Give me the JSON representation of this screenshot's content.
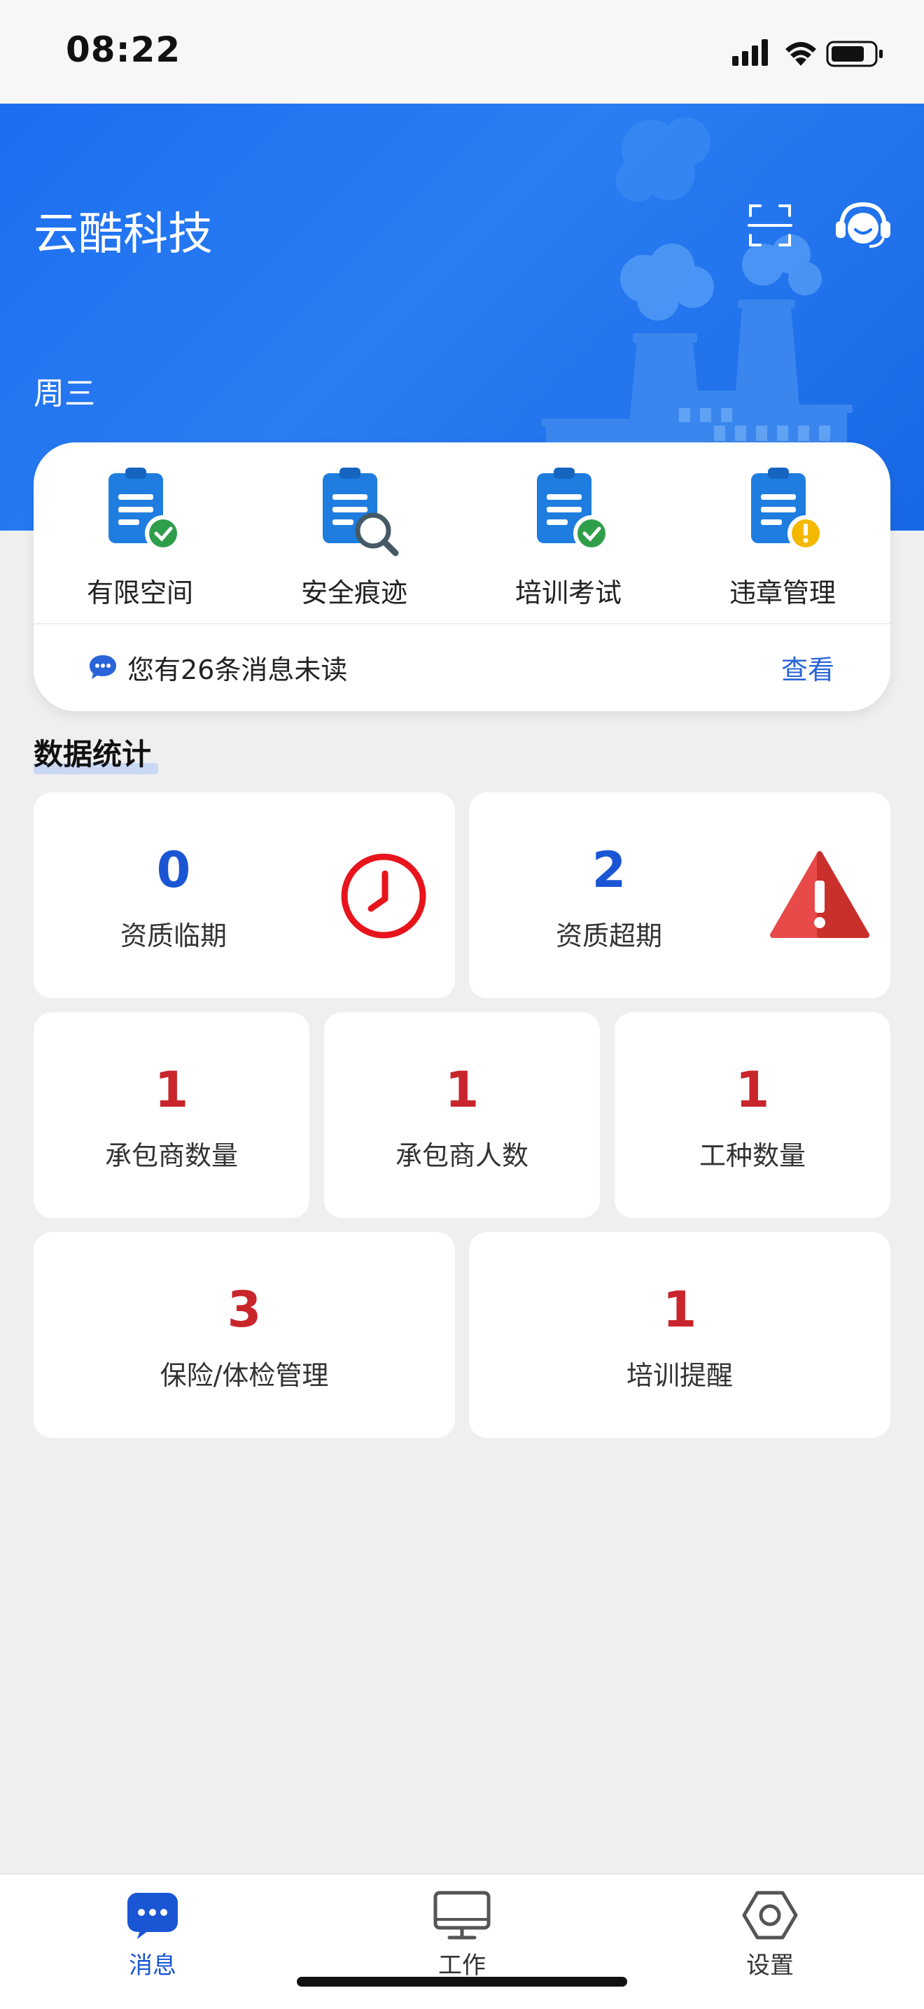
{
  "status_bar": {
    "time": "08:22"
  },
  "header": {
    "app_title": "云酷科技",
    "weekday": "周三",
    "scan_icon": "scan-icon",
    "support_icon": "customer-service-icon"
  },
  "quick_actions": [
    {
      "label": "有限空间",
      "icon": "clipboard-check-icon"
    },
    {
      "label": "安全痕迹",
      "icon": "clipboard-search-icon"
    },
    {
      "label": "培训考试",
      "icon": "clipboard-check-icon"
    },
    {
      "label": "违章管理",
      "icon": "clipboard-warning-icon"
    }
  ],
  "messages": {
    "text": "您有26条消息未读",
    "link": "查看",
    "icon": "chat-bubble-icon"
  },
  "stats_section": {
    "title": "数据统计"
  },
  "stats": {
    "qual_expiring": {
      "value": "0",
      "label": "资质临期",
      "icon": "clock-icon"
    },
    "qual_expired": {
      "value": "2",
      "label": "资质超期",
      "icon": "warning-triangle-icon"
    },
    "contractor_count": {
      "value": "1",
      "label": "承包商数量"
    },
    "contractor_people": {
      "value": "1",
      "label": "承包商人数"
    },
    "job_types": {
      "value": "1",
      "label": "工种数量"
    },
    "insurance": {
      "value": "3",
      "label": "保险/体检管理"
    },
    "training": {
      "value": "1",
      "label": "培训提醒"
    }
  },
  "tabbar": [
    {
      "label": "消息",
      "icon": "message-icon",
      "active": true
    },
    {
      "label": "工作",
      "icon": "monitor-icon",
      "active": false
    },
    {
      "label": "设置",
      "icon": "settings-hexagon-icon",
      "active": false
    }
  ],
  "colors": {
    "accent": "#1c6ef0",
    "stat_blue": "#1a56d4",
    "stat_red": "#c8262c",
    "success": "#2f9e4a",
    "warning": "#f5b800"
  }
}
